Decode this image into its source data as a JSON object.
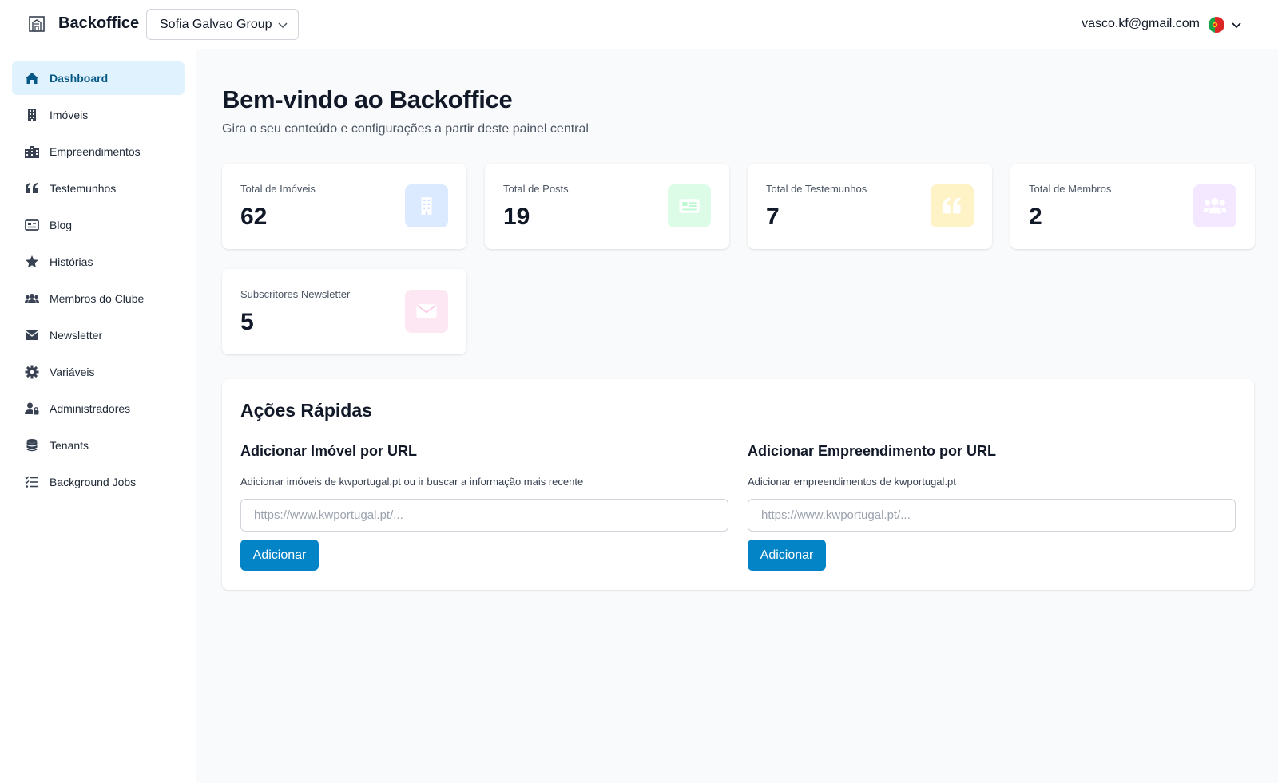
{
  "header": {
    "brand": "Backoffice",
    "tenant": "Sofia Galvao Group",
    "user_email": "vasco.kf@gmail.com"
  },
  "sidebar": {
    "items": [
      {
        "label": "Dashboard",
        "icon": "home-icon",
        "active": true
      },
      {
        "label": "Imóveis",
        "icon": "building-icon"
      },
      {
        "label": "Empreendimentos",
        "icon": "city-icon"
      },
      {
        "label": "Testemunhos",
        "icon": "quote-icon"
      },
      {
        "label": "Blog",
        "icon": "newspaper-icon"
      },
      {
        "label": "Histórias",
        "icon": "star-icon"
      },
      {
        "label": "Membros do Clube",
        "icon": "users-icon"
      },
      {
        "label": "Newsletter",
        "icon": "envelope-icon"
      },
      {
        "label": "Variáveis",
        "icon": "gear-icon"
      },
      {
        "label": "Administradores",
        "icon": "user-lock-icon"
      },
      {
        "label": "Tenants",
        "icon": "database-icon"
      },
      {
        "label": "Background Jobs",
        "icon": "tasks-icon"
      }
    ]
  },
  "main": {
    "title": "Bem-vindo ao Backoffice",
    "subtitle": "Gira o seu conteúdo e configurações a partir deste painel central",
    "stats": [
      {
        "label": "Total de Imóveis",
        "value": "62",
        "icon": "building-icon",
        "bg": "#dbeafe",
        "fg": "#93c5fd"
      },
      {
        "label": "Total de Posts",
        "value": "19",
        "icon": "newspaper-icon",
        "bg": "#dcfce7",
        "fg": "#86efac"
      },
      {
        "label": "Total de Testemunhos",
        "value": "7",
        "icon": "quote-icon",
        "bg": "#fef3c7",
        "fg": "#fcd34d"
      },
      {
        "label": "Total de Membros",
        "value": "2",
        "icon": "users-icon",
        "bg": "#f3e8ff",
        "fg": "#d8b4fe"
      },
      {
        "label": "Subscritores Newsletter",
        "value": "5",
        "icon": "envelope-icon",
        "bg": "#fce7f3",
        "fg": "#f9a8d4"
      }
    ],
    "quick_actions": {
      "title": "Ações Rápidas",
      "property": {
        "title": "Adicionar Imóvel por URL",
        "description": "Adicionar imóveis de kwportugal.pt ou ir buscar a informação mais recente",
        "placeholder": "https://www.kwportugal.pt/...",
        "button": "Adicionar"
      },
      "development": {
        "title": "Adicionar Empreendimento por URL",
        "description": "Adicionar empreendimentos de kwportugal.pt",
        "placeholder": "https://www.kwportugal.pt/...",
        "button": "Adicionar"
      }
    }
  },
  "colors": {
    "accent": "#0284c7",
    "active_nav_bg": "#e0f2fe",
    "active_nav_text": "#075985"
  }
}
